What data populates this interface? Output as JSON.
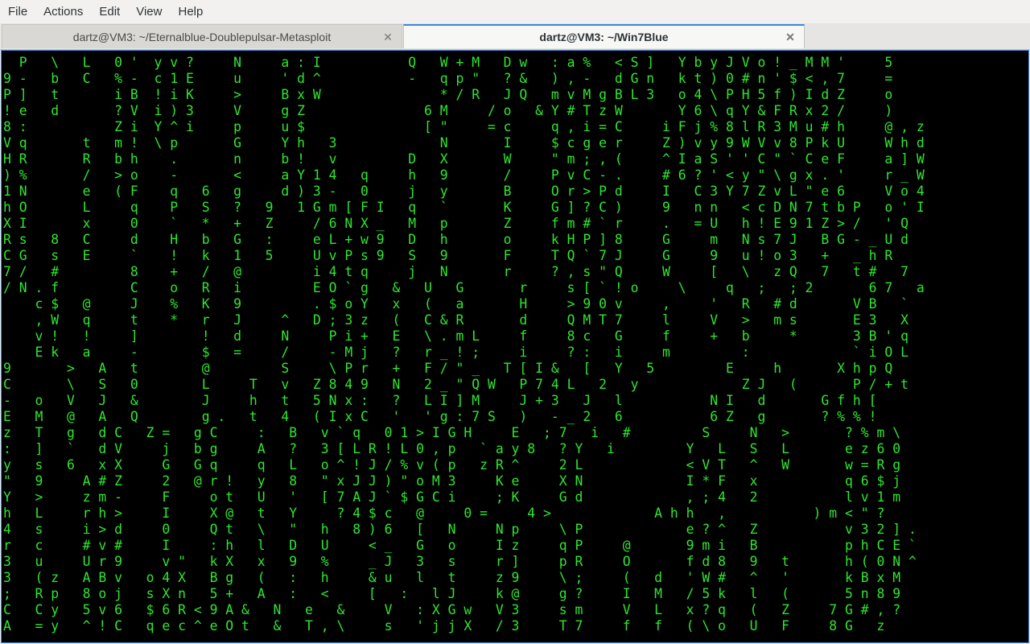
{
  "menubar": {
    "items": [
      "File",
      "Actions",
      "Edit",
      "View",
      "Help"
    ]
  },
  "tabs": [
    {
      "title": "dartz@VM3: ~/Eternalblue-Doublepulsar-Metasploit",
      "active": false,
      "close_icon": "close-icon"
    },
    {
      "title": "dartz@VM3: ~/Win7Blue",
      "active": true,
      "close_icon": "close-icon"
    }
  ],
  "terminal": {
    "text_color": "#2ee62e",
    "highlight_color": "#ffffff",
    "background": "#000000",
    "lines": [
      "  P   \\   L   0 '  y v ?     N     a : I           Q   W + M   D w   : a %   < S ]   Y b y J V o ! _ M M '     5",
      "9 -   b   C   % -  c 1 E     u     ' d ^           -   q p \"   ? &   ) , -   d G n   k t ) 0 # n ' $ < , 7     =",
      "P ]   t       i B  ! i K     >     B x W               * / R   J Q   m v M g B L 3   o 4 \\ P H 5 f ) I d Z     o",
      "! e   d       ? V  i ) 3     V     g Z               6 M     / o   & Y # T z W       Y 6 \\ q Y & F R x 2 /     )",
      "8 :           Z i  Y ^ i     p     u $               [ \"     = c     q , i = C     i F j % 8 l R 3 M u # h     @ , z",
      "V q       t   m !  \\ p       G     Y h   3             N       I     $ c g e r     Z ) v y 9 W V v 8 P k U     W h d",
      "H R       R   b h    .       n     b !   v         D   X       W     \" m ; , (     ^ I a S ' ' C \" ` C e F     a ] W",
      ") %       /   > o    -       <     a Y 1 4   q     h   9       /     P v C - .     # 6 ? ' < y \" \\ g x . '     r _ W",
      "1 N       e   ( F    q   6   g     d ) 3 -   0     j   y       B     O r > P d     I   C 3 Y 7 Z v L \" e 6     V o 4",
      "h O       L     q    P   S   ?   9   1 G m [ F I   q   `       K     G ] ? C )     9   n n   < c D N 7 t b P   o ' I",
      "X I       x     0    `   *   +   Z     / 6 N X _   M   p       Z     f m # ` r     .   = U   h ! E 9 1 Z > /   ' Q",
      "R s   8   C     d    H   b   G   :     e L + w 9   D   h       o     k H P ] 8     G     m   N s 7 J   B G - _ U d",
      "C G   s   E     `    !   k   1   5     U v P s 9   S   9       F     T Q ` 7 J     G     9   u ! o 3   +   _ h R",
      "7 /   #         8    +   /   @         i 4 t q     j   N       r     ? , s \" Q     W     [   \\   z Q   7   t #   7",
      "/ N . f         C    o   R   i         E O ` g   &   U   G       r     s [ ` ! o     \\     q   ;   ; 2       6 7   a",
      "    c $   @     J    %   K   9         . $ o Y   x   (   a       H     > 9 0 v     ,     '   R   # d       V B   `",
      "    , W   q     t    *   r   J     ^   D ; 3 z   (   C & R       d     Q M T 7     l     V   >   m s       E 3   X",
      "    v !   !     ]        !   d     N     P i +   E   \\ . m L     f     8 c   G     f     +   b     *       3 B ' q",
      "    E k   a     -        $   =     /     - M j   ?   r _ ! ;     i     ? :   i     m         :             ` i O L",
      "9       >   A   t        @         S     \\ P r   +   F / \" _   T [ I &   [   Y   5         E     h       X h p Q",
      "C       \\   S   0        L     T   v   Z 8 4 9   N   2 _ \" Q W   P 7 4 L   2   y             Z J   (       P / + t",
      "-   o   V   J   &        J     h   t   5 N x :   ?   L I ] M     J + 3   J   l           N I   d       G f h [",
      "E   M   @   A   Q        g .   t   4   ( I x C   '   ' g : 7 S   )   - _ 2   6           6 Z   g       ? % % !",
      "z   T   g   d C   Z =   g C     :   B   v ` q   0 1 > I G H     E   ; 7   i   #         S     N   >       ? % m \\",
      ":   ]   `   d V     j   b g     A   ?   3 [ L R ! L 0 , p   ` a y 8   ? Y   i         Y   L   S   L       e z 6 0",
      "y   s   6   x X     G   G q     q   L   o ^ ! J / % v ( p   z R ^     2 L             < V T   ^   W       w = R g",
      "\"   9     A # Z     2   @ r !   y   8   \" x J J ) \" o M 3     K e     X N             I * F   x           q 6 $ j",
      "Y   >     z m -     F     o t   U   '   [ 7 A J ` $ G C i     ; K     G d             , ; 4   2           l v 1 m",
      "h   L     r h >     I     X @   t   Y     ? 4 $ c   @     0 =     4 >             A h h   ,           ) m < \" ?",
      "4   s     i > d     0     Q t   \\   \"   h   8 ) 6   [   N     N p     \\ P             e ? ^   Z           v 3 2 ] .",
      "r   c     # v #     I     : h   l   D   U     < _   G   o     I z     q P     @       9 m i   B           p h C E `",
      "3   u     U r 9     v \"   k X   x   9   %     _ J   3   s     r ]     p R     O       f d 8   9   t       h ( 0 N ^",
      "3   ( z   A B v   o 4 X   B g   (   :   h     & u   l   t     z 9     \\ ;     (   d   ' W #   ^   '       k B x M",
      ";   R p   8 o j   s X n   5 +   A   :   <     [   :   l J     k @     g ?     I   M   / 5 k   l   (       5 n 8 9",
      "C   C y   5 v 6   $ 6 R < 9 A &   N   e   &     V   : X G w   V 3     s m     V   L   x ? q   (   Z     7 G # , ?",
      "A   = y   ^ ! C   q e c ^ e O t   &   T , \\     s   ' j j X   / 3     T 7     f   f   ( \\ o   U   F     8 G   z"
    ]
  }
}
